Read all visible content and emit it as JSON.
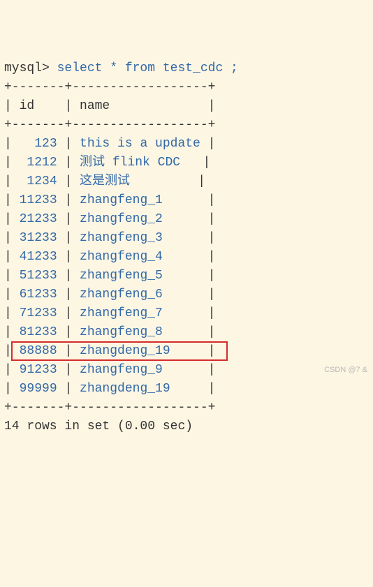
{
  "prompt": "mysql>",
  "sql": " select * from test_cdc ;",
  "separator": "+-------+------------------+",
  "columns": {
    "id": "id",
    "name": "name"
  },
  "rows": [
    {
      "id": "123",
      "name": "this is a update"
    },
    {
      "id": "1212",
      "name": "测试 flink CDC"
    },
    {
      "id": "1234",
      "name": "这是测试"
    },
    {
      "id": "11233",
      "name": "zhangfeng_1"
    },
    {
      "id": "21233",
      "name": "zhangfeng_2"
    },
    {
      "id": "31233",
      "name": "zhangfeng_3"
    },
    {
      "id": "41233",
      "name": "zhangfeng_4"
    },
    {
      "id": "51233",
      "name": "zhangfeng_5"
    },
    {
      "id": "61233",
      "name": "zhangfeng_6"
    },
    {
      "id": "71233",
      "name": "zhangfeng_7"
    },
    {
      "id": "81233",
      "name": "zhangfeng_8"
    },
    {
      "id": "88888",
      "name": "zhangdeng_19",
      "highlight": true
    },
    {
      "id": "91233",
      "name": "zhangfeng_9"
    },
    {
      "id": "99999",
      "name": "zhangdeng_19"
    }
  ],
  "footer": "14 rows in set (0.00 sec)",
  "watermark": "CSDN @7 &",
  "chart_data": {
    "type": "table",
    "title": "select * from test_cdc",
    "columns": [
      "id",
      "name"
    ],
    "rows": [
      [
        123,
        "this is a update"
      ],
      [
        1212,
        "测试 flink CDC"
      ],
      [
        1234,
        "这是测试"
      ],
      [
        11233,
        "zhangfeng_1"
      ],
      [
        21233,
        "zhangfeng_2"
      ],
      [
        31233,
        "zhangfeng_3"
      ],
      [
        41233,
        "zhangfeng_4"
      ],
      [
        51233,
        "zhangfeng_5"
      ],
      [
        61233,
        "zhangfeng_6"
      ],
      [
        71233,
        "zhangfeng_7"
      ],
      [
        81233,
        "zhangfeng_8"
      ],
      [
        88888,
        "zhangdeng_19"
      ],
      [
        91233,
        "zhangfeng_9"
      ],
      [
        99999,
        "zhangdeng_19"
      ]
    ]
  }
}
